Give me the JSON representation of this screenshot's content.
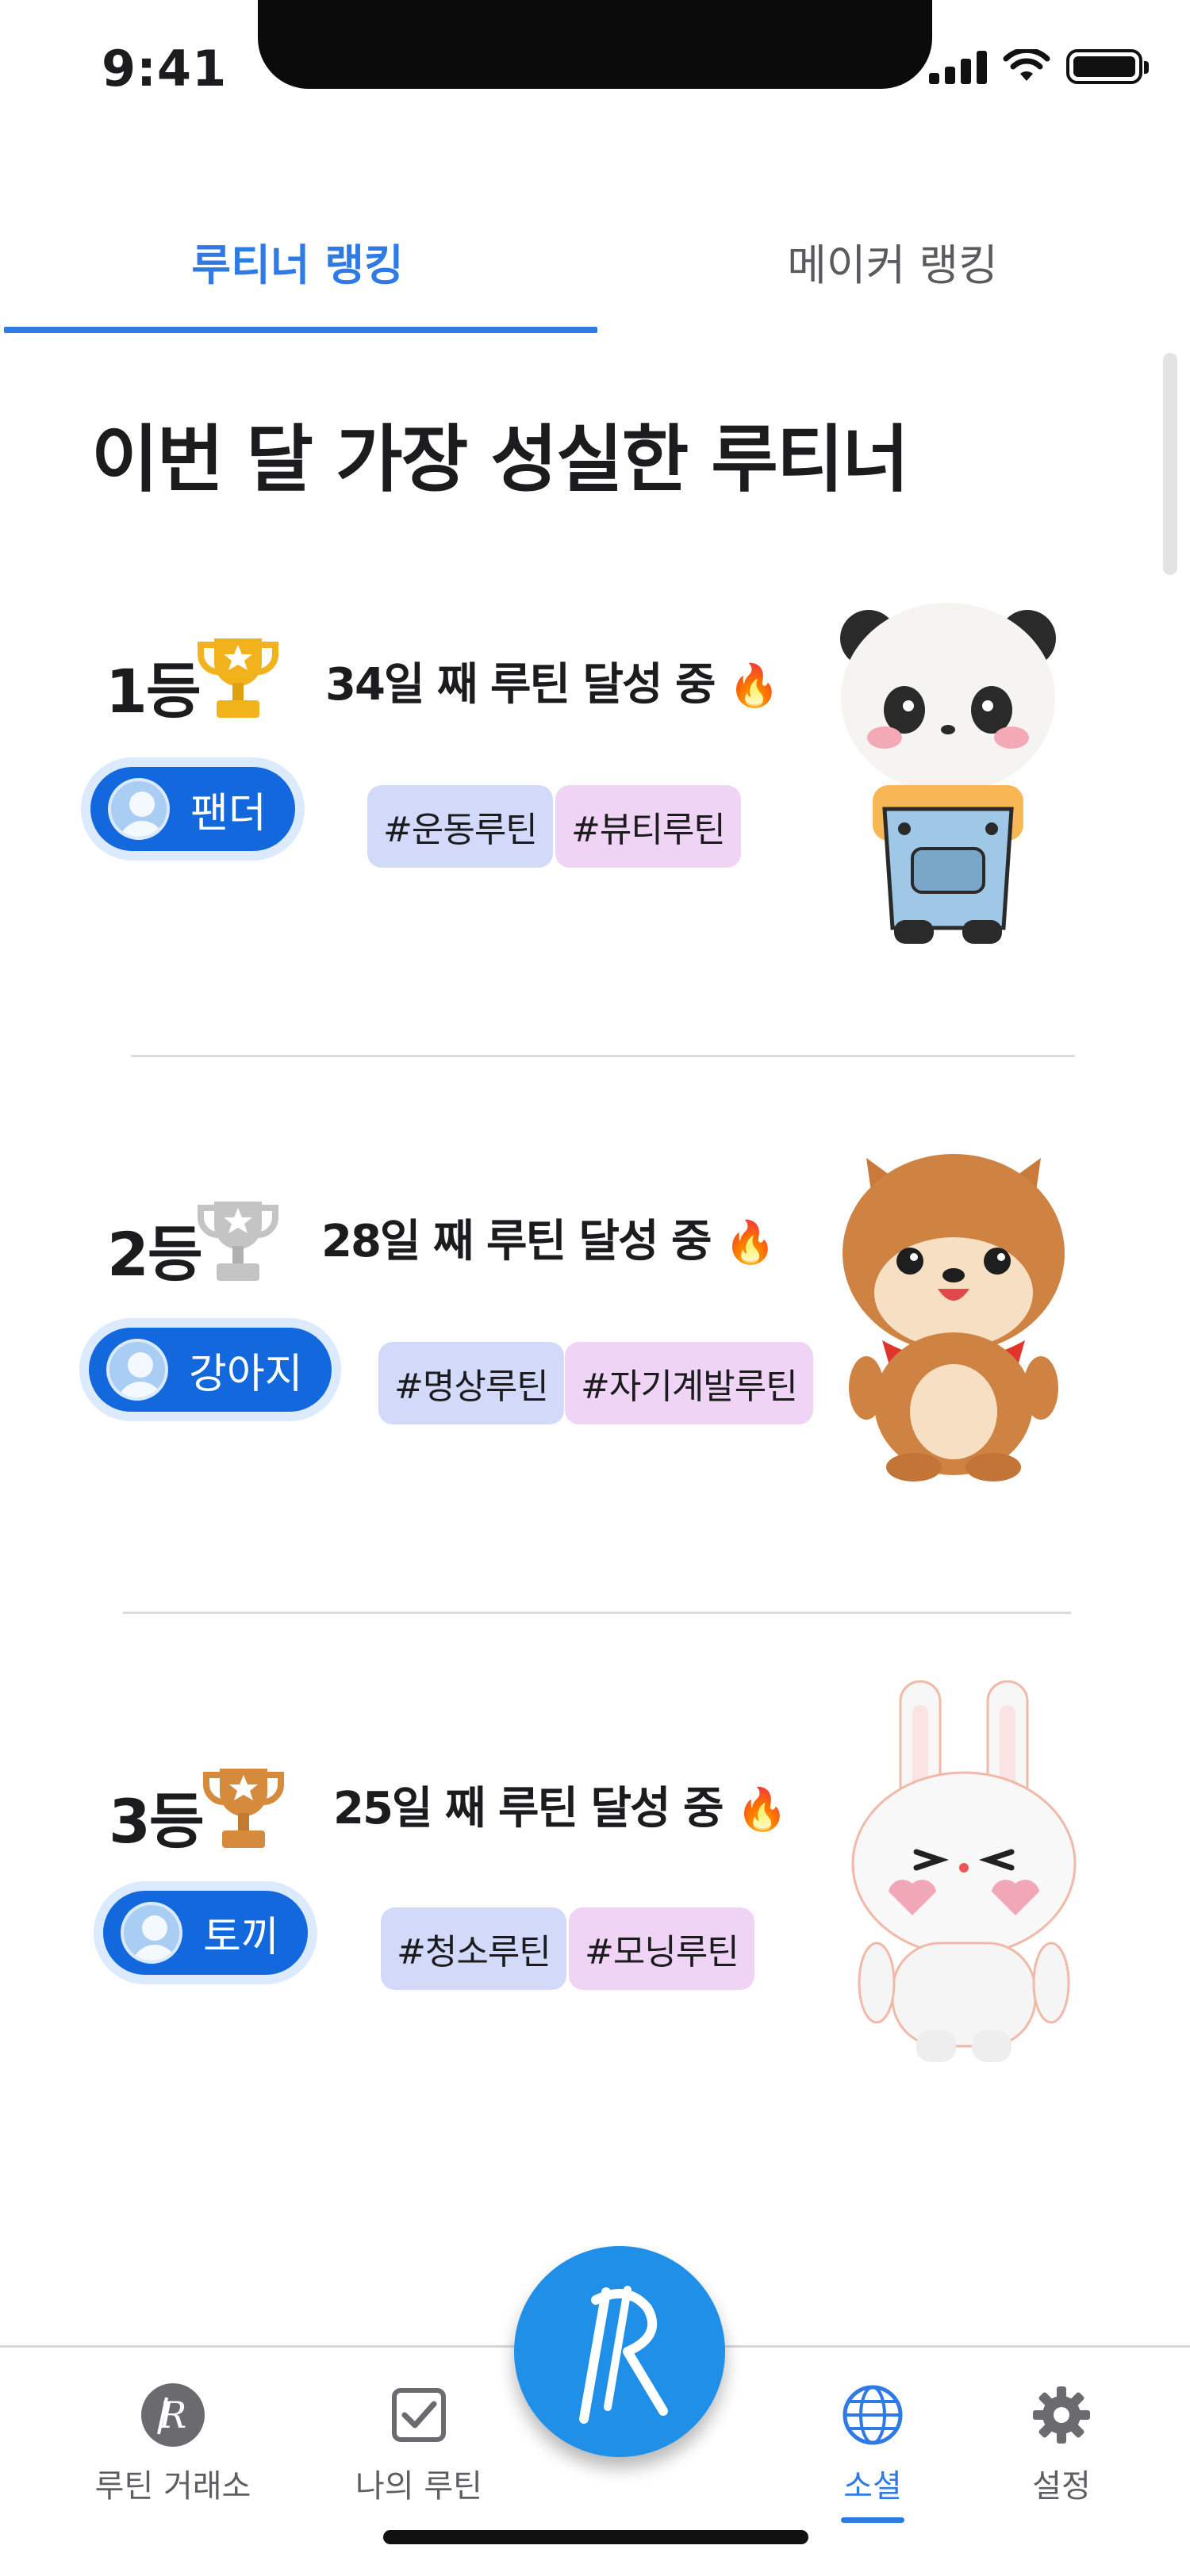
{
  "status_bar": {
    "time": "9:41"
  },
  "tabs": [
    {
      "label": "루티너 랭킹",
      "active": true
    },
    {
      "label": "메이커 랭킹",
      "active": false
    }
  ],
  "section_title": "이번 달 가장 성실한 루티너",
  "rankings": [
    {
      "rank": "1등",
      "trophy": "gold-trophy-icon",
      "streak": "34일 째 루틴 달성 중",
      "user": "팬더",
      "tags": [
        "#운동루틴",
        "#뷰티루틴"
      ],
      "character": "panda"
    },
    {
      "rank": "2등",
      "trophy": "silver-trophy-icon",
      "streak": "28일 째 루틴 달성 중",
      "user": "강아지",
      "tags": [
        "#명상루틴",
        "#자기계발루틴"
      ],
      "character": "dog"
    },
    {
      "rank": "3등",
      "trophy": "bronze-trophy-icon",
      "streak": "25일 째 루틴 달성 중",
      "user": "토끼",
      "tags": [
        "#청소루틴",
        "#모닝루틴"
      ],
      "character": "rabbit"
    }
  ],
  "bottom_nav": {
    "items": [
      {
        "label": "루틴 거래소",
        "icon": "coin-icon",
        "active": false
      },
      {
        "label": "나의 루틴",
        "icon": "checkbox-icon",
        "active": false
      },
      {
        "label": "소셜",
        "icon": "globe-icon",
        "active": true
      },
      {
        "label": "설정",
        "icon": "gear-icon",
        "active": false
      }
    ],
    "fab_icon": "routine-logo-icon"
  },
  "colors": {
    "accent": "#2f7ae5",
    "pill": "#1268dc",
    "tag_blue": "#d3daf9",
    "tag_pink": "#f0d4f6",
    "gold": "#f2b21b",
    "silver": "#c4c4c4",
    "bronze": "#d68a3c"
  }
}
